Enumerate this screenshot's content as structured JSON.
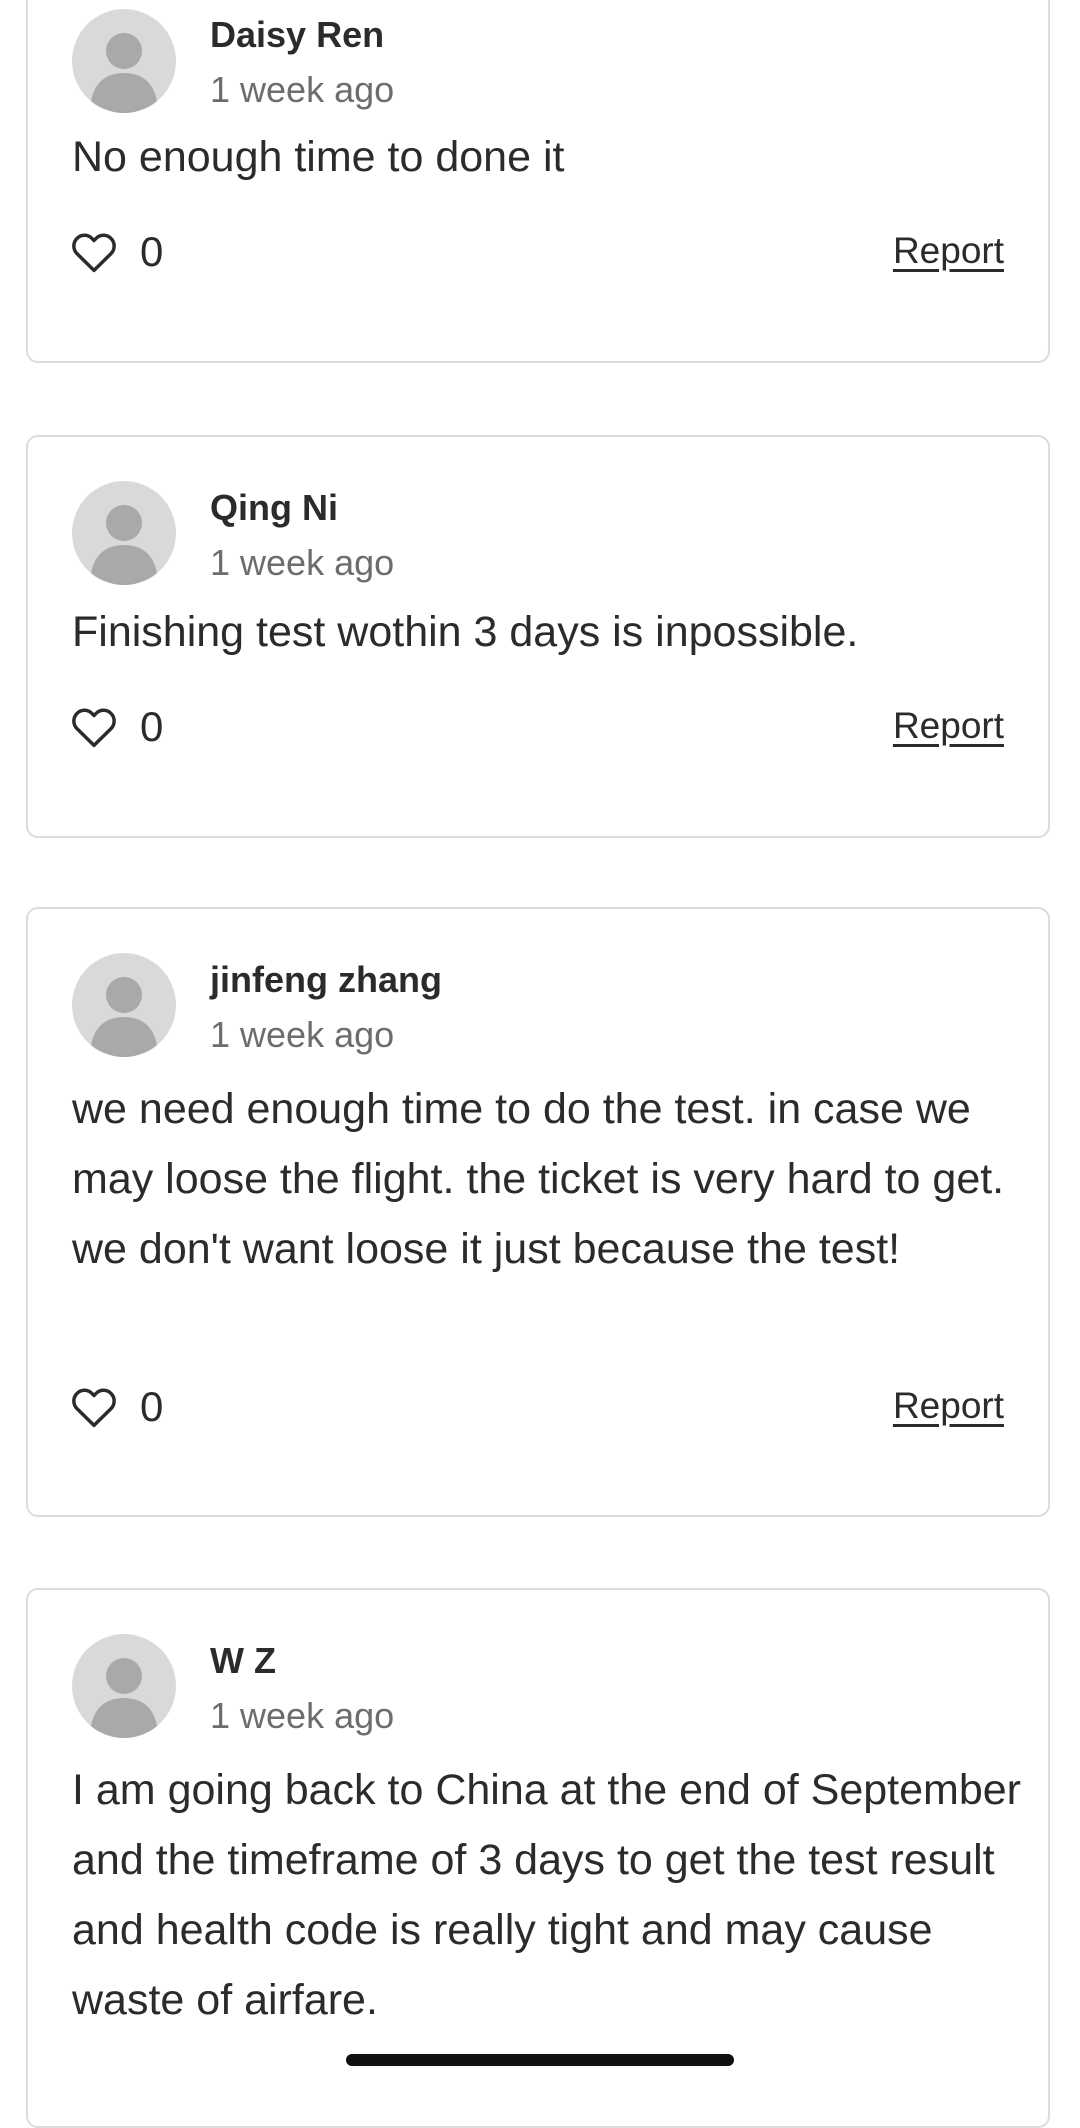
{
  "comments": [
    {
      "author": "Daisy Ren",
      "time": "1 week ago",
      "text": "No enough time to done it",
      "likes": "0",
      "report_label": "Report"
    },
    {
      "author": "Qing Ni",
      "time": "1 week ago",
      "text": "Finishing test wothin 3 days is inpossible.",
      "likes": "0",
      "report_label": "Report"
    },
    {
      "author": "jinfeng zhang",
      "time": "1 week ago",
      "text": "we need enough time to do the test. in case we may loose the flight. the ticket is very hard to get. we don't want loose it just because the test!",
      "likes": "0",
      "report_label": "Report"
    },
    {
      "author": "W Z",
      "time": "1 week ago",
      "text": "I am going back to China at the end of September and the timeframe of 3 days to get the test result and health code is really tight and may cause waste of airfare.",
      "likes": "0",
      "report_label": "Report"
    }
  ],
  "icons": {
    "like": "heart-outline-icon",
    "avatar": "default-user-avatar"
  },
  "colors": {
    "card_border": "#dcdcdc",
    "avatar_bg": "#d9d9d9",
    "avatar_figure": "#a9a9a9",
    "text": "#2b2b2b",
    "muted_text": "#6d6d6d"
  }
}
